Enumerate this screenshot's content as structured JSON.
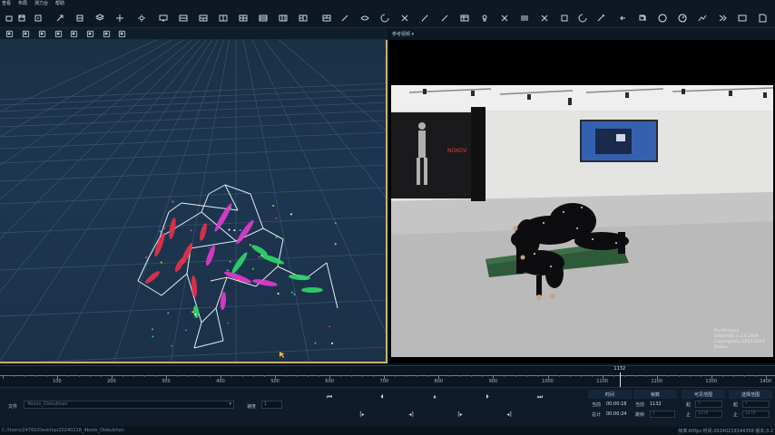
{
  "menubar": {
    "items": [
      "查看",
      "布局",
      "测力台",
      "帮助"
    ]
  },
  "toolbar": {
    "icons": [
      "folder-open-icon",
      "save-icon",
      "save-as-icon",
      "link-icon",
      "export-icon",
      "layers-icon",
      "calibrate-icon",
      "settings-icon",
      "display-icon",
      "panel-split-icon",
      "panel-split-2-icon",
      "panel-split-3-icon",
      "panel-grid-icon",
      "panel-grid-2-icon",
      "panel-grid-3-icon",
      "panel-grid-4-icon",
      "panel-grid-5-icon",
      "bone-link-icon",
      "eye-icon",
      "refresh-marker-icon",
      "cut-icon",
      "marker-connect-icon",
      "bone-icon",
      "table-icon",
      "bulb-icon",
      "cross-icon",
      "sliders-icon",
      "scissors-icon",
      "target-icon",
      "rotate-icon",
      "wand-icon",
      "undo-icon",
      "copy-icon",
      "record-icon",
      "gauge-icon",
      "graph-icon",
      "forward-icon",
      "word-icon",
      "document-icon",
      "chart-icon"
    ]
  },
  "viewport_toolbar": {
    "icons": [
      "view-front-icon",
      "view-side-icon",
      "view-top-icon",
      "view-perspective-icon",
      "view-camera-icon",
      "cube-icon",
      "reset-view-icon",
      "fit-icon"
    ]
  },
  "reference": {
    "label": "参考视频 ▾",
    "watermark": [
      "PostProcess",
      "XINGYING 3.2.0.2009",
      "Copyright(C) 2015-2024 Nokov"
    ],
    "banner_text": "NOKOV"
  },
  "timeline": {
    "ticks": [
      "100",
      "200",
      "300",
      "400",
      "500",
      "600",
      "700",
      "800",
      "900",
      "1000",
      "1100",
      "1200",
      "1300",
      "1400"
    ],
    "current_frame": "1132"
  },
  "controls": {
    "file_label": "文件",
    "file_value": "4bods_Diekubhan",
    "speed_label": "速度",
    "speed_value": "1",
    "buttons": [
      "skip-start-icon",
      "step-back-icon",
      "pause-icon",
      "step-forward-icon",
      "skip-end-icon"
    ],
    "sub_buttons": [
      "mark-in-icon",
      "set-in-icon",
      "set-out-icon",
      "mark-out-icon"
    ]
  },
  "stats": {
    "headers": [
      "时间",
      "帧数",
      "可见范围",
      "选择范围"
    ],
    "current_label": "当前",
    "current_time": "00:00:18",
    "current_frames_label": "当前",
    "current_frame": "1132",
    "total_label": "总计",
    "total_time": "00:00:24",
    "total_frames_label": "跳帧",
    "total_frames": "1",
    "vis_start_label": "起",
    "vis_start": "1",
    "vis_end_label": "止",
    "vis_end": "1479",
    "sel_start_label": "起",
    "sel_start": "1",
    "sel_end_label": "止",
    "sel_end": "1479"
  },
  "status": {
    "path": "C:/Users/24760/Desktop/20240218_4bods_Diekubhan",
    "right": "帧率:60fps 时间:20240219144358 版本:3.2"
  },
  "colors": {
    "accent": "#c9b26a",
    "viewport_bg": "#1b3249",
    "skeleton_white": "#e8eef4",
    "marker_red": "#e8304a",
    "marker_magenta": "#e43ad0",
    "marker_green": "#2fd86a"
  }
}
